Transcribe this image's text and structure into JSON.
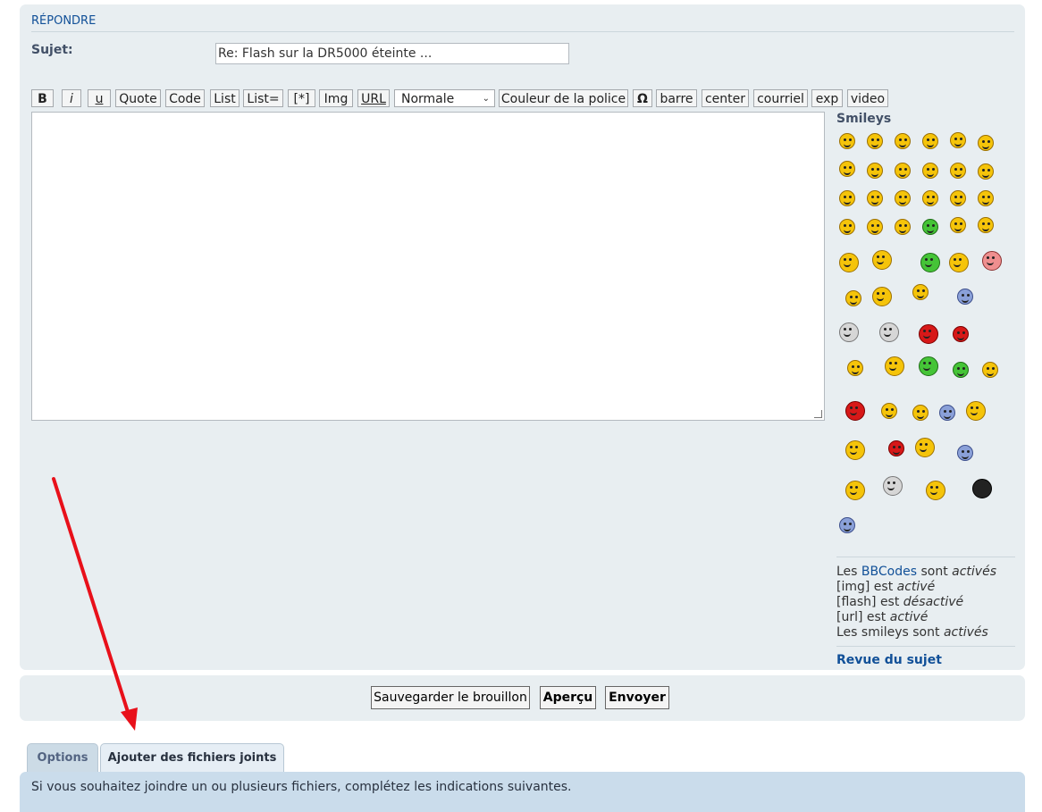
{
  "form": {
    "heading": "RÉPONDRE",
    "subject_label": "Sujet:",
    "subject_value": "Re: Flash sur la DR5000 éteinte ..."
  },
  "toolbar": {
    "buttons": [
      "B",
      "i",
      "u",
      "Quote",
      "Code",
      "List",
      "List=",
      "[*]",
      "Img",
      "URL",
      "Couleur de la police",
      "Ω",
      "barre",
      "center",
      "courriel",
      "exp",
      "video"
    ],
    "font_size_select": "Normale"
  },
  "sidebar": {
    "smileys_title": "Smileys",
    "bbcode": {
      "prefix": "Les ",
      "link": "BBCodes",
      "middle": " sont ",
      "state": "activés"
    },
    "img": {
      "prefix": "[img] est ",
      "state": "activé"
    },
    "flash": {
      "prefix": "[flash] est ",
      "state": "désactivé"
    },
    "url": {
      "prefix": "[url] est ",
      "state": "activé"
    },
    "smileys_status": {
      "prefix": "Les smileys sont ",
      "state": "activés"
    },
    "review_link": "Revue du sujet"
  },
  "actions": {
    "save_draft": "Sauvegarder le brouillon",
    "preview": "Aperçu",
    "submit": "Envoyer"
  },
  "tabs": {
    "options": "Options",
    "attachments": "Ajouter des fichiers joints"
  },
  "attachments": {
    "instructions": "Si vous souhaitez joindre un ou plusieurs fichiers, complétez les indications suivantes."
  },
  "colors": {
    "panel": "#e8eef1",
    "link": "#115098",
    "annotation_arrow": "#e8101a",
    "attach_panel": "#cadceb"
  }
}
